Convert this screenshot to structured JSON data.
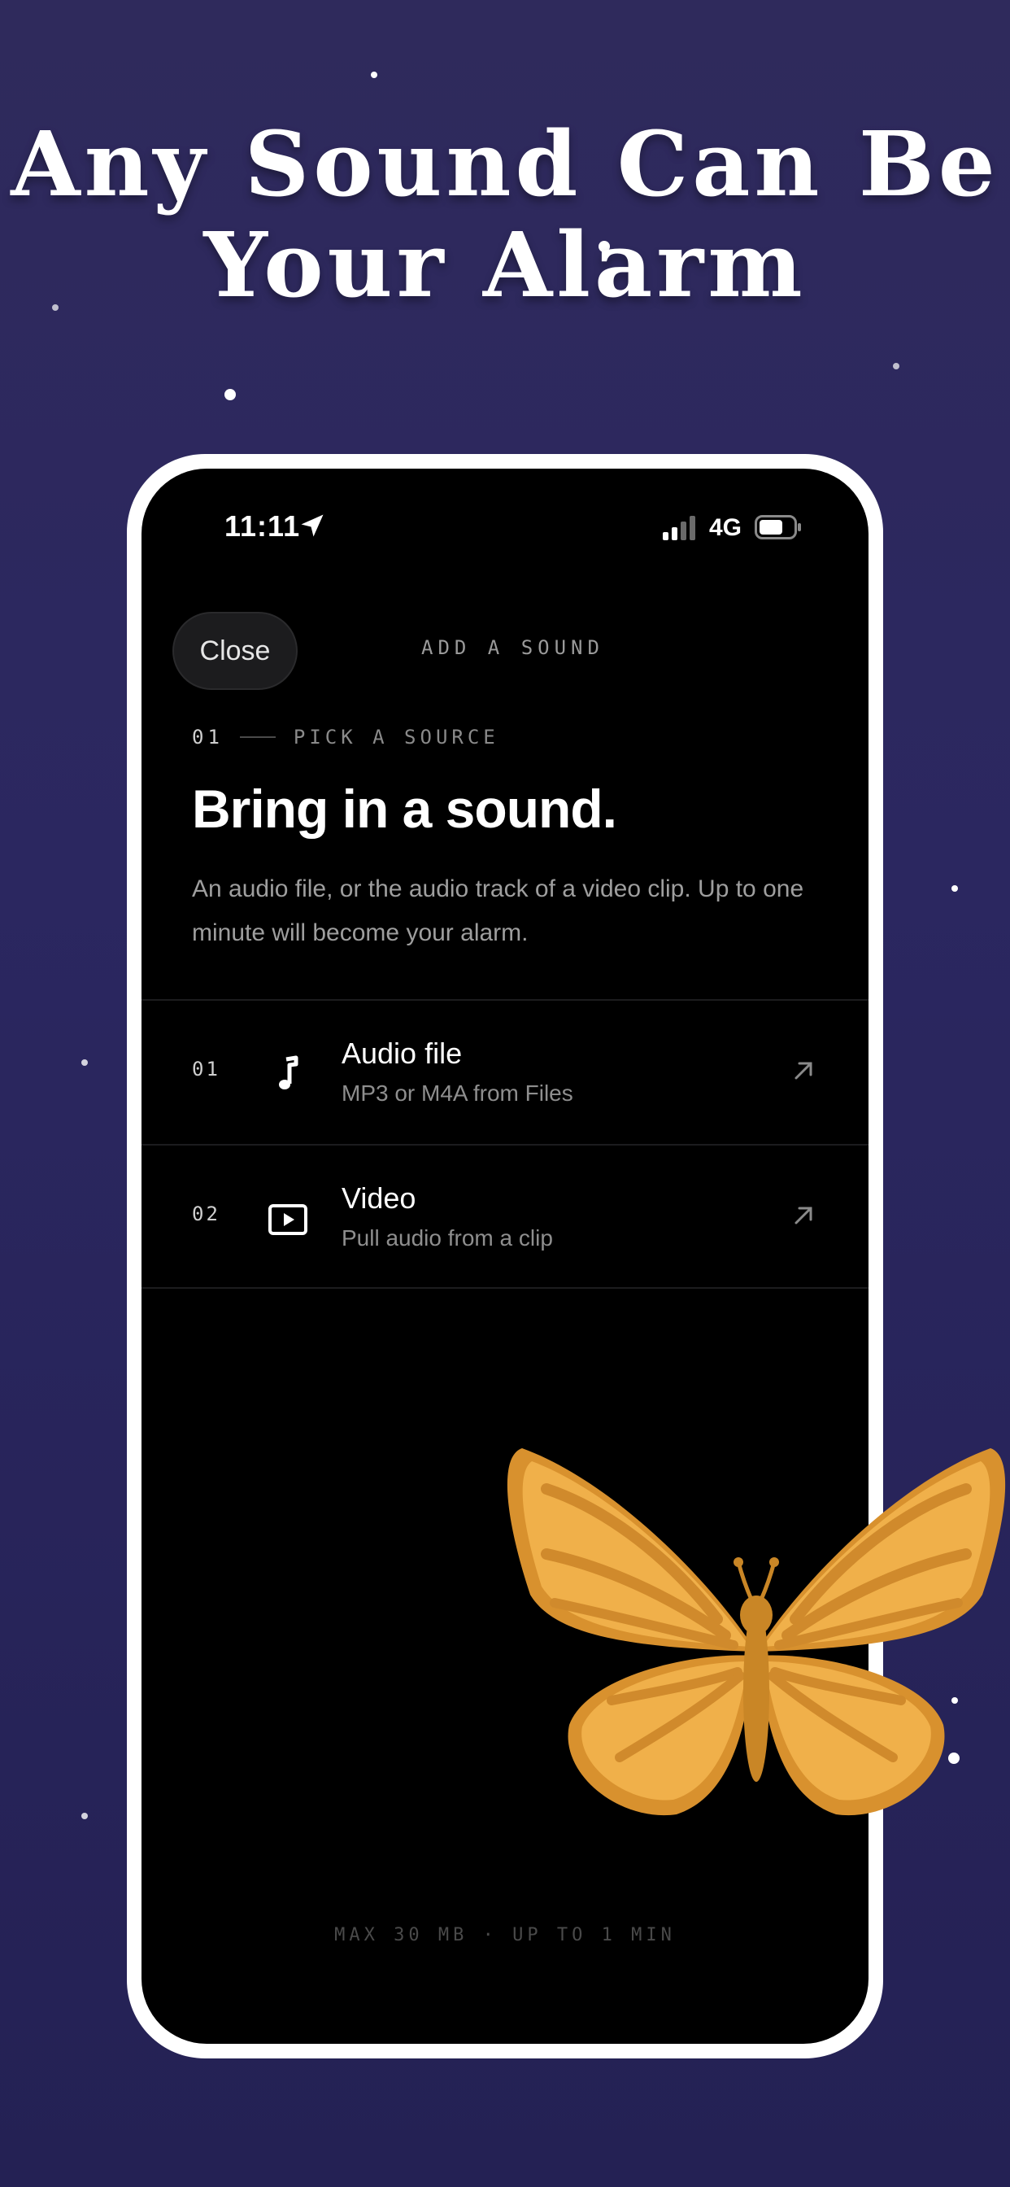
{
  "promo": {
    "headline_line1": "Any Sound Can Be",
    "headline_line2": "Your Alarm"
  },
  "status_bar": {
    "time": "11:11",
    "network": "4G"
  },
  "nav": {
    "close_label": "Close",
    "title": "ADD A SOUND"
  },
  "step": {
    "number": "01",
    "label": "PICK A SOURCE"
  },
  "main": {
    "heading": "Bring in a sound.",
    "description": "An audio file, or the audio track of a video clip. Up to one minute will become your alarm."
  },
  "sources": [
    {
      "number": "01",
      "title": "Audio file",
      "subtitle": "MP3 or M4A from Files",
      "icon": "music-note-icon"
    },
    {
      "number": "02",
      "title": "Video",
      "subtitle": "Pull audio from a clip",
      "icon": "video-play-icon"
    }
  ],
  "footer": {
    "note": "MAX 30 MB · UP TO 1 MIN"
  },
  "colors": {
    "background": "#2b2760",
    "butterfly": "#e8a93c",
    "screen": "#000000"
  }
}
